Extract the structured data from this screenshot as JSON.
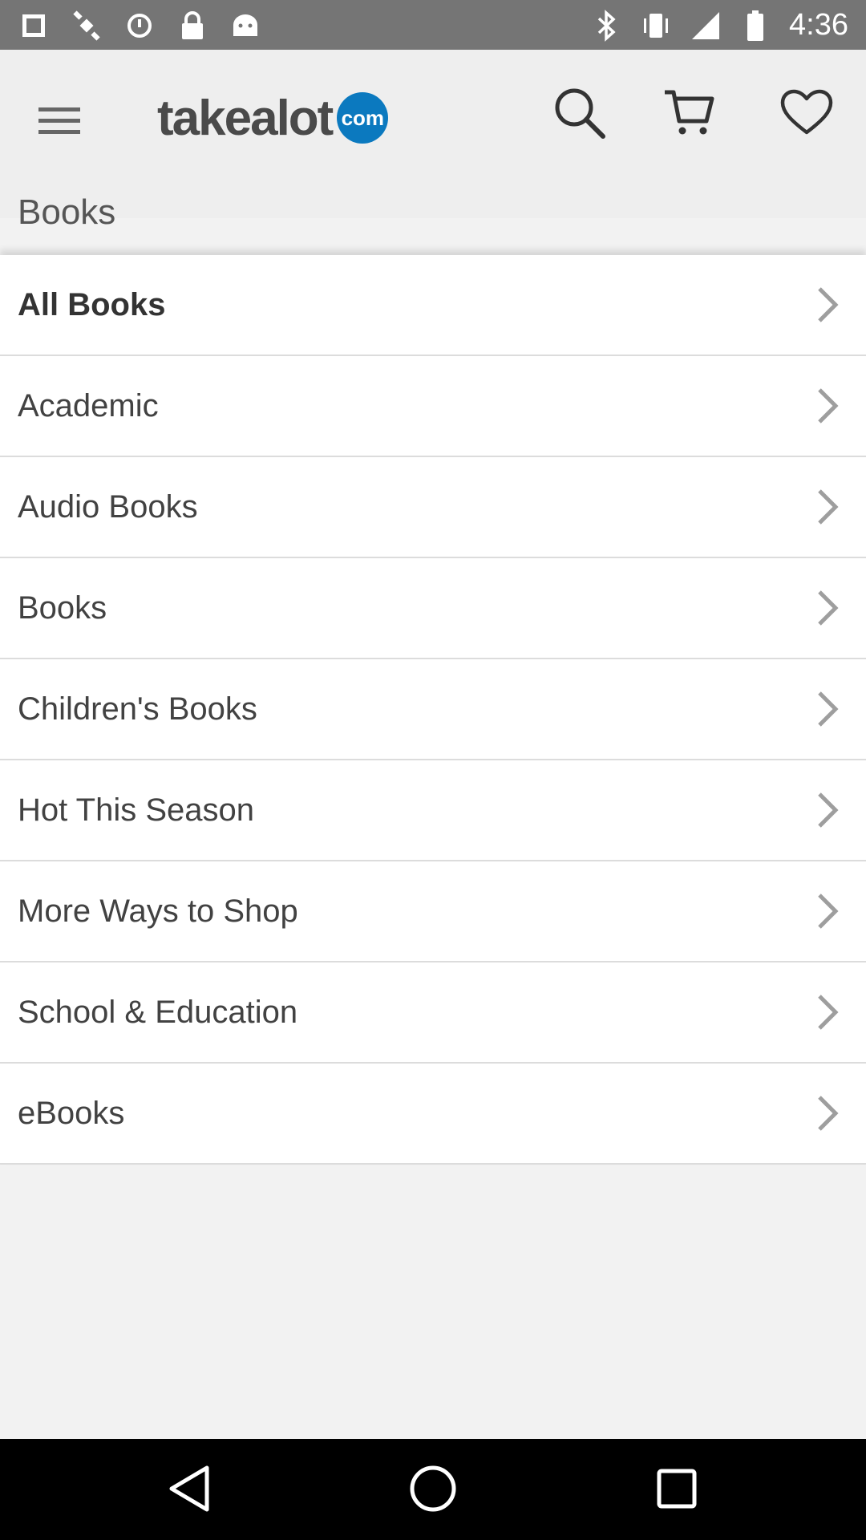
{
  "status_bar": {
    "time": "4:36",
    "icons": [
      "fake-gps-icon",
      "satellite-icon",
      "sync-icon",
      "lock-icon",
      "android-icon",
      "bluetooth-icon",
      "vibrate-icon",
      "signal-icon",
      "battery-icon"
    ]
  },
  "app_bar": {
    "logo_text": "takealot",
    "logo_badge": "com",
    "page_title": "Books",
    "icons": [
      "menu-icon",
      "search-icon",
      "cart-icon",
      "heart-icon"
    ]
  },
  "categories": [
    {
      "label": "All Books"
    },
    {
      "label": "Academic"
    },
    {
      "label": "Audio Books"
    },
    {
      "label": "Books"
    },
    {
      "label": "Children's Books"
    },
    {
      "label": "Hot This Season"
    },
    {
      "label": "More Ways to Shop"
    },
    {
      "label": "School & Education"
    },
    {
      "label": "eBooks"
    }
  ],
  "nav_bar": {
    "icons": [
      "back-icon",
      "home-icon",
      "recent-apps-icon"
    ]
  },
  "colors": {
    "brand_blue": "#0b79bf",
    "status_bar": "#757575",
    "app_bar": "#eeeeee"
  }
}
